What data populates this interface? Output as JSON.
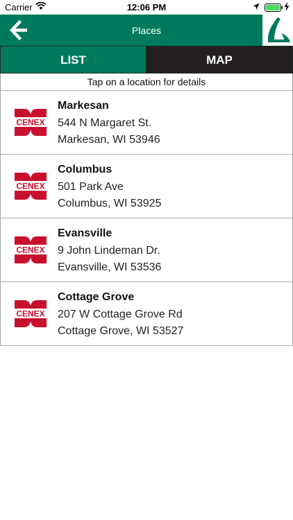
{
  "status_bar": {
    "carrier": "Carrier",
    "time": "12:06 PM"
  },
  "nav": {
    "title": "Places",
    "back_icon": "arrow-left-icon",
    "logo_icon": "brand-swoosh-logo",
    "accent_color": "#007a5c"
  },
  "tabs": [
    {
      "label": "LIST",
      "selected": true
    },
    {
      "label": "MAP",
      "selected": false
    }
  ],
  "hint": "Tap on a location for details",
  "places": [
    {
      "name": "Markesan",
      "address_line1": "544 N Margaret St.",
      "address_line2": "Markesan, WI 53946",
      "logo": "CENEX"
    },
    {
      "name": "Columbus",
      "address_line1": "501 Park Ave",
      "address_line2": "Columbus, WI 53925",
      "logo": "CENEX"
    },
    {
      "name": "Evansville",
      "address_line1": "9 John Lindeman Dr.",
      "address_line2": "Evansville, WI 53536",
      "logo": "CENEX"
    },
    {
      "name": "Cottage Grove",
      "address_line1": "207 W Cottage Grove Rd",
      "address_line2": "Cottage Grove, WI 53527",
      "logo": "CENEX"
    }
  ]
}
